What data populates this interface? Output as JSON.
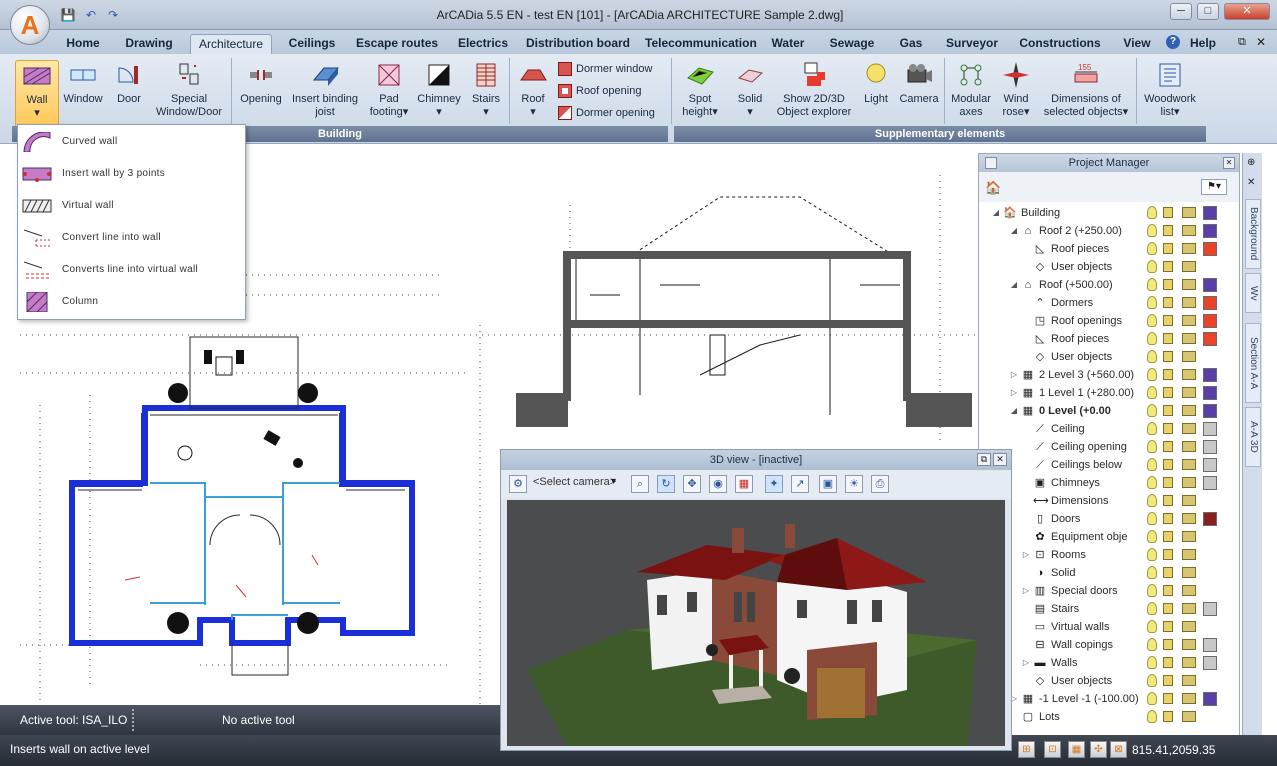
{
  "window": {
    "title": "ArCADia 5.5 EN - test EN [101] - [ArCADia ARCHITECTURE Sample 2.dwg]",
    "logo_letter": "A",
    "minimize": "─",
    "maximize": "□",
    "close": "✕"
  },
  "quick_access": {
    "save": "💾",
    "undo": "↶",
    "redo": "↷"
  },
  "tabs": [
    {
      "label": "Home"
    },
    {
      "label": "Drawing"
    },
    {
      "label": "Architecture"
    },
    {
      "label": "Ceilings"
    },
    {
      "label": "Escape routes"
    },
    {
      "label": "Electrics"
    },
    {
      "label": "Distribution board"
    },
    {
      "label": "Telecommunication"
    },
    {
      "label": "Water"
    },
    {
      "label": "Sewage"
    },
    {
      "label": "Gas"
    },
    {
      "label": "Surveyor"
    },
    {
      "label": "Constructions"
    },
    {
      "label": "View"
    }
  ],
  "help_label": "Help",
  "ribbon": {
    "building": {
      "group_label": "Building",
      "wall": "Wall",
      "window": "Window",
      "door": "Door",
      "special_1": "Special",
      "special_2": "Window/Door",
      "opening": "Opening",
      "joist_1": "Insert binding",
      "joist_2": "joist",
      "pad_1": "Pad",
      "pad_2": "footing",
      "chimney": "Chimney",
      "stairs": "Stairs",
      "roof": "Roof",
      "dormer_window": "Dormer window",
      "roof_opening": "Roof opening",
      "dormer_opening": "Dormer opening"
    },
    "supplementary": {
      "group_label": "Supplementary elements",
      "spot_1": "Spot",
      "spot_2": "height",
      "solid": "Solid",
      "show_1": "Show 2D/3D",
      "show_2": "Object explorer",
      "light": "Light",
      "camera": "Camera",
      "modular_1": "Modular",
      "modular_2": "axes",
      "wind_1": "Wind",
      "wind_2": "rose",
      "dim_1": "Dimensions of",
      "dim_2": "selected objects",
      "woodwork_1": "Woodwork",
      "woodwork_2": "list",
      "dim_badge": "155"
    }
  },
  "wall_menu": {
    "items": [
      {
        "label": "Curved wall"
      },
      {
        "label": "Insert wall by 3 points"
      },
      {
        "label": "Virtual wall"
      },
      {
        "label": "Convert line into wall"
      },
      {
        "label": "Converts line into virtual wall"
      },
      {
        "label": "Column"
      }
    ]
  },
  "view3d": {
    "title": "3D view - [inactive]",
    "camera_placeholder": "<Select camera>"
  },
  "project_manager": {
    "title": "Project Manager",
    "tree": [
      {
        "label": "Building",
        "level": 0,
        "expander": "◢",
        "icon": "building-icon",
        "glyph": "🏠",
        "swatch": "#5a3fa8"
      },
      {
        "label": "Roof 2 (+250.00)",
        "level": 1,
        "expander": "◢",
        "icon": "roof-level-icon",
        "glyph": "⌂",
        "swatch": "#5a3fa8"
      },
      {
        "label": "Roof pieces",
        "level": 2,
        "expander": "",
        "icon": "roof-pieces-icon",
        "glyph": "◺",
        "swatch": "#e8442a"
      },
      {
        "label": "User objects",
        "level": 2,
        "expander": "",
        "icon": "user-objects-icon",
        "glyph": "◇",
        "swatch": ""
      },
      {
        "label": "Roof (+500.00)",
        "level": 1,
        "expander": "◢",
        "icon": "roof-level-icon",
        "glyph": "⌂",
        "swatch": "#5a3fa8"
      },
      {
        "label": "Dormers",
        "level": 2,
        "expander": "",
        "icon": "dormers-icon",
        "glyph": "⌃",
        "swatch": "#e8442a"
      },
      {
        "label": "Roof openings",
        "level": 2,
        "expander": "",
        "icon": "roof-openings-icon",
        "glyph": "◳",
        "swatch": "#e8442a"
      },
      {
        "label": "Roof pieces",
        "level": 2,
        "expander": "",
        "icon": "roof-pieces-icon",
        "glyph": "◺",
        "swatch": "#e8442a"
      },
      {
        "label": "User objects",
        "level": 2,
        "expander": "",
        "icon": "user-objects-icon",
        "glyph": "◇",
        "swatch": ""
      },
      {
        "label": "2 Level 3 (+560.00)",
        "level": 1,
        "expander": "▷",
        "icon": "level-icon",
        "glyph": "▦",
        "swatch": "#5a3fa8"
      },
      {
        "label": "1 Level 1 (+280.00)",
        "level": 1,
        "expander": "▷",
        "icon": "level-icon",
        "glyph": "▦",
        "swatch": "#5a3fa8"
      },
      {
        "label": "0 Level (+0.00",
        "level": 1,
        "expander": "◢",
        "icon": "level-icon",
        "glyph": "▦",
        "swatch": "#5a3fa8",
        "bold": true
      },
      {
        "label": "Ceiling",
        "level": 2,
        "expander": "",
        "icon": "ceiling-icon",
        "glyph": "⟋",
        "swatch": "#c8c8c8"
      },
      {
        "label": "Ceiling opening",
        "level": 2,
        "expander": "",
        "icon": "ceiling-opening-icon",
        "glyph": "⟋",
        "swatch": "#c8c8c8"
      },
      {
        "label": "Ceilings below",
        "level": 2,
        "expander": "",
        "icon": "ceilings-below-icon",
        "glyph": "⟋",
        "swatch": "#c8c8c8"
      },
      {
        "label": "Chimneys",
        "level": 2,
        "expander": "",
        "icon": "chimneys-icon",
        "glyph": "▣",
        "swatch": "#c8c8c8"
      },
      {
        "label": "Dimensions",
        "level": 2,
        "expander": "",
        "icon": "dimensions-icon",
        "glyph": "⟷",
        "swatch": ""
      },
      {
        "label": "Doors",
        "level": 2,
        "expander": "",
        "icon": "doors-icon",
        "glyph": "▯",
        "swatch": "#8b1e1e"
      },
      {
        "label": "Equipment obje",
        "level": 2,
        "expander": "",
        "icon": "equipment-icon",
        "glyph": "✿",
        "swatch": ""
      },
      {
        "label": "Rooms",
        "level": 2,
        "expander": "▷",
        "icon": "rooms-icon",
        "glyph": "⊡",
        "swatch": ""
      },
      {
        "label": "Solid",
        "level": 2,
        "expander": "",
        "icon": "solid-icon",
        "glyph": "◑",
        "swatch": ""
      },
      {
        "label": "Special doors",
        "level": 2,
        "expander": "▷",
        "icon": "special-doors-icon",
        "glyph": "▥",
        "swatch": ""
      },
      {
        "label": "Stairs",
        "level": 2,
        "expander": "",
        "icon": "stairs-icon",
        "glyph": "▤",
        "swatch": "#c8c8c8"
      },
      {
        "label": "Virtual walls",
        "level": 2,
        "expander": "",
        "icon": "virtual-walls-icon",
        "glyph": "▭",
        "swatch": ""
      },
      {
        "label": "Wall copings",
        "level": 2,
        "expander": "",
        "icon": "wall-copings-icon",
        "glyph": "⊟",
        "swatch": "#c8c8c8"
      },
      {
        "label": "Walls",
        "level": 2,
        "expander": "▷",
        "icon": "walls-icon",
        "glyph": "▬",
        "swatch": "#c8c8c8"
      },
      {
        "label": "User objects",
        "level": 2,
        "expander": "",
        "icon": "user-objects-icon",
        "glyph": "◇",
        "swatch": ""
      },
      {
        "label": "-1 Level -1 (-100.00)",
        "level": 1,
        "expander": "▷",
        "icon": "level-icon",
        "glyph": "▦",
        "swatch": "#5a3fa8"
      },
      {
        "label": "Lots",
        "level": 1,
        "expander": "",
        "icon": "lots-icon",
        "glyph": "▢",
        "swatch": ""
      }
    ]
  },
  "side_tabs": [
    {
      "label": "Background"
    },
    {
      "label": "Wv"
    },
    {
      "label": "Section A-A"
    },
    {
      "label": "A-A 3D"
    }
  ],
  "status": {
    "active_tool": "Active tool: ISA_ILO",
    "no_active_tool": "No active tool",
    "hint": "Inserts wall on active level",
    "coords": "815.41,2059.35"
  }
}
